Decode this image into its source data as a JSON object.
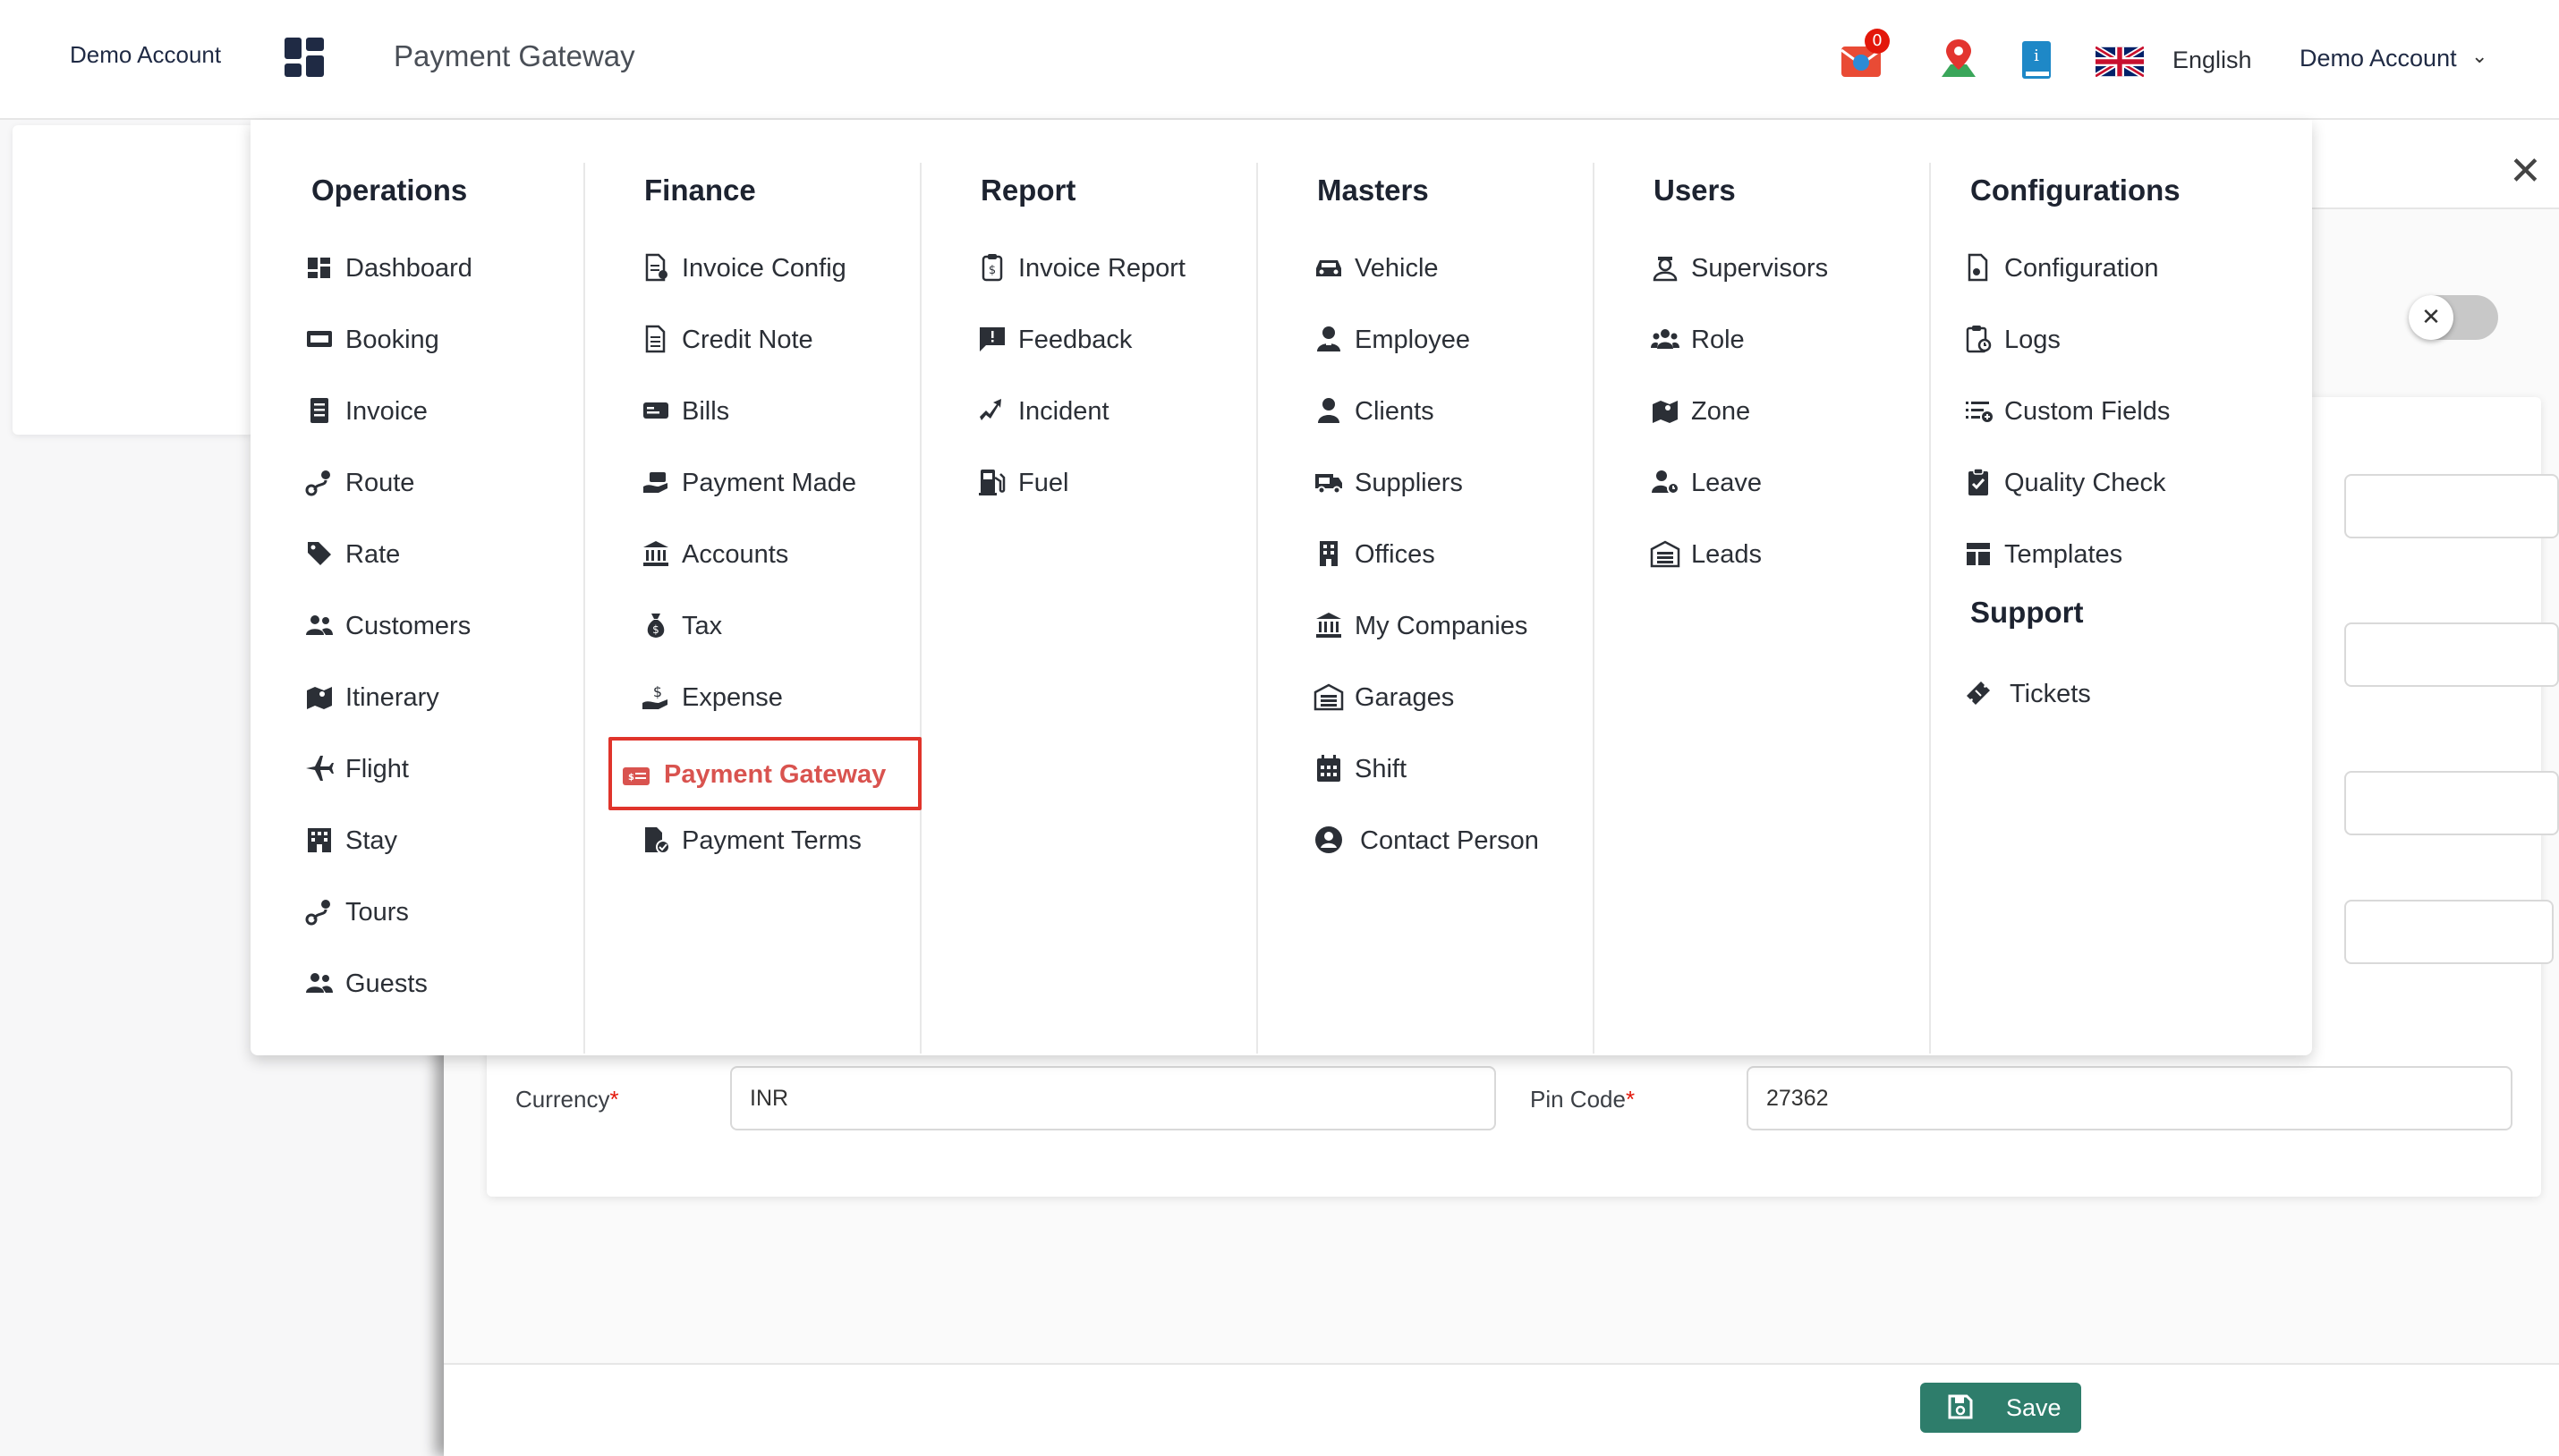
{
  "header": {
    "account_left": "Demo Account",
    "title": "Payment Gateway",
    "notification_count": "0",
    "language": "English",
    "account_right": "Demo Account",
    "chevron": "⌄"
  },
  "menu": {
    "operations": {
      "title": "Operations",
      "items": [
        "Dashboard",
        "Booking",
        "Invoice",
        "Route",
        "Rate",
        "Customers",
        "Itinerary",
        "Flight",
        "Stay",
        "Tours",
        "Guests"
      ]
    },
    "finance": {
      "title": "Finance",
      "items": [
        "Invoice Config",
        "Credit Note",
        "Bills",
        "Payment Made",
        "Accounts",
        "Tax",
        "Expense",
        "Payment Gateway",
        "Payment Terms"
      ],
      "active_item": "Payment Gateway"
    },
    "report": {
      "title": "Report",
      "items": [
        "Invoice Report",
        "Feedback",
        "Incident",
        "Fuel"
      ]
    },
    "masters": {
      "title": "Masters",
      "items": [
        "Vehicle",
        "Employee",
        "Clients",
        "Suppliers",
        "Offices",
        "My Companies",
        "Garages",
        "Shift",
        "Contact Person"
      ]
    },
    "users": {
      "title": "Users",
      "items": [
        "Supervisors",
        "Role",
        "Zone",
        "Leave",
        "Leads"
      ]
    },
    "configurations": {
      "title": "Configurations",
      "items": [
        "Configuration",
        "Logs",
        "Custom Fields",
        "Quality Check",
        "Templates"
      ]
    },
    "support": {
      "title": "Support",
      "items": [
        "Tickets"
      ]
    }
  },
  "form": {
    "currency_label": "Currency",
    "currency_value": "INR",
    "pincode_label": "Pin Code",
    "pincode_value": "27362",
    "required_mark": "*"
  },
  "footer": {
    "save_label": "Save"
  },
  "colors": {
    "active": "#d9534f",
    "save_button": "#2e7d6b",
    "badge": "#e3170a"
  }
}
